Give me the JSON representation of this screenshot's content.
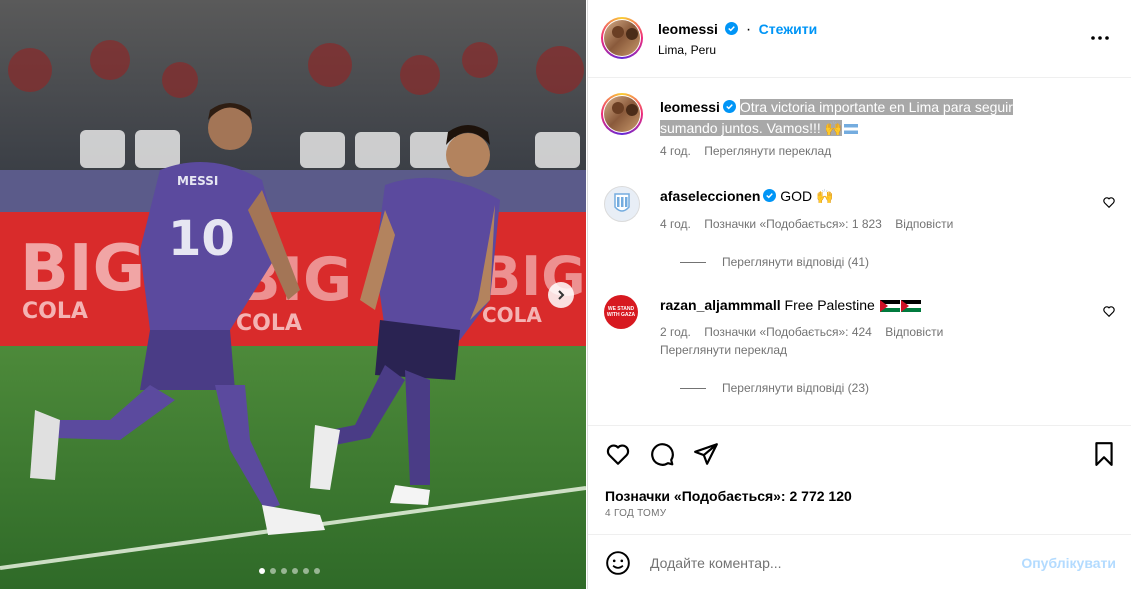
{
  "post": {
    "author": "leomessi",
    "follow_label": "Стежити",
    "location": "Lima, Peru",
    "caption": "Otra victoria importante en Lima para seguir sumando juntos. Vamos!!! 🙌",
    "caption_age": "4 год.",
    "see_translation": "Переглянути переклад",
    "banner_text": [
      "BIG",
      "COLA"
    ],
    "jersey_name": "MESSI",
    "jersey_number": "10"
  },
  "comments": [
    {
      "username": "afaseleccionen",
      "text": "GOD 🙌",
      "age": "4 год.",
      "likes": "Позначки «Подобається»: 1 823",
      "reply": "Відповісти",
      "view_replies": "Переглянути відповіді (41)"
    },
    {
      "username": "razan_aljammmall",
      "text": "Free Palestine",
      "avatar_text": "WE STAND WITH GAZA",
      "age": "2 год.",
      "likes": "Позначки «Подобається»: 424",
      "reply": "Відповісти",
      "see_translation": "Переглянути переклад",
      "view_replies": "Переглянути відповіді (23)"
    }
  ],
  "actions": {
    "likes_count": "Позначки «Подобається»: 2 772 120",
    "timestamp": "4 ГОД ТОМУ"
  },
  "composer": {
    "placeholder": "Додайте коментар...",
    "publish_label": "Опублікувати"
  },
  "carousel": {
    "total": 6,
    "active_index": 1
  },
  "colors": {
    "accent": "#0095f6",
    "publish_disabled": "#b3dbff",
    "jersey": "#5b4a9e"
  }
}
